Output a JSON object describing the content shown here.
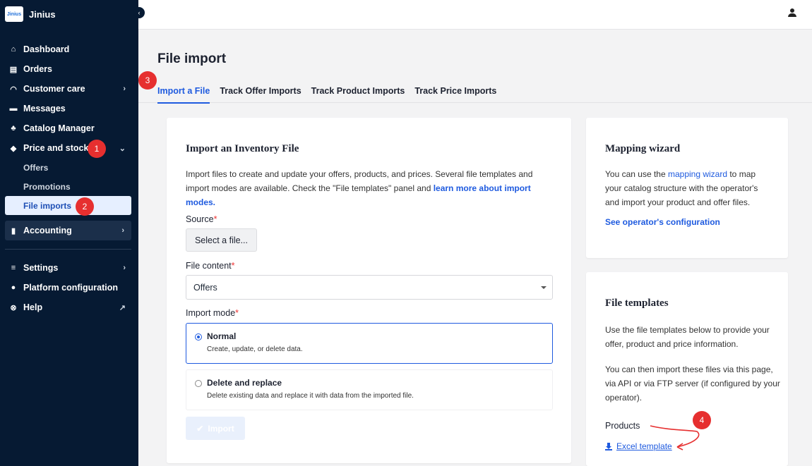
{
  "app": {
    "logo_text": "Jinius",
    "name": "Jinius"
  },
  "sidebar": {
    "items": [
      {
        "label": "Dashboard",
        "icon": "home-icon"
      },
      {
        "label": "Orders",
        "icon": "clipboard-icon"
      },
      {
        "label": "Customer care",
        "icon": "headset-icon"
      },
      {
        "label": "Messages",
        "icon": "message-icon"
      },
      {
        "label": "Catalog Manager",
        "icon": "catalog-icon"
      },
      {
        "label": "Price and stock",
        "icon": "tag-icon"
      }
    ],
    "sub_items": [
      {
        "label": "Offers"
      },
      {
        "label": "Promotions"
      },
      {
        "label": "File imports"
      }
    ],
    "accounting": "Accounting",
    "settings": "Settings",
    "platform_configuration": "Platform configuration",
    "help": "Help"
  },
  "annotations": [
    "1",
    "2",
    "3",
    "4"
  ],
  "page": {
    "title": "File import",
    "tabs": [
      "Import a File",
      "Track Offer Imports",
      "Track Product Imports",
      "Track Price Imports"
    ]
  },
  "import_card": {
    "title": "Import an Inventory File",
    "desc_1": "Import files to create and update your offers, products, and prices. Several file templates and import modes are available. Check the \"File templates\" panel and ",
    "desc_link": "learn more about import modes.",
    "source_label": "Source",
    "required_mark": "*",
    "select_file_label": "Select a file...",
    "content_label": "File content",
    "content_value": "Offers",
    "mode_label": "Import mode",
    "mode_normal_title": "Normal",
    "mode_normal_desc": "Create, update, or delete data.",
    "mode_replace_title": "Delete and replace",
    "mode_replace_desc": "Delete existing data and replace it with data from the imported file.",
    "import_button": "Import"
  },
  "mapping_card": {
    "title": "Mapping wizard",
    "text_1": "You can use the ",
    "link": "mapping wizard",
    "text_2": " to map your catalog structure with the operator's and import your product and offer files.",
    "config_link": "See operator's configuration"
  },
  "templates_card": {
    "title": "File templates",
    "para_1": "Use the file templates below to provide your offer, product and price information.",
    "para_2": "You can then import these files via this page, via API or via FTP server (if configured by your operator).",
    "products_label": "Products",
    "excel_link": "Excel template"
  },
  "colors": {
    "sidebar_bg": "#061a33",
    "accent": "#1e5adf",
    "badge": "#e62f2f"
  }
}
